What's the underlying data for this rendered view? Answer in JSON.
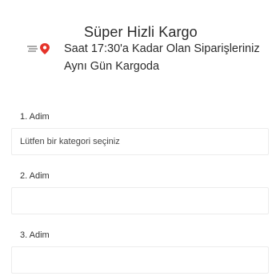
{
  "promo": {
    "title": "Süper Hizli Kargo",
    "line1": "Saat 17:30'a Kadar Olan Siparişleriniz",
    "line2": "Aynı Gün Kargoda",
    "logo_icon": "delivery-pin-icon",
    "accent_color": "#e5332a"
  },
  "steps": [
    {
      "label": "1. Adim",
      "field_text": "Lütfen bir kategori seçiniz"
    },
    {
      "label": "2. Adim",
      "field_text": ""
    },
    {
      "label": "3. Adim",
      "field_text": ""
    }
  ]
}
